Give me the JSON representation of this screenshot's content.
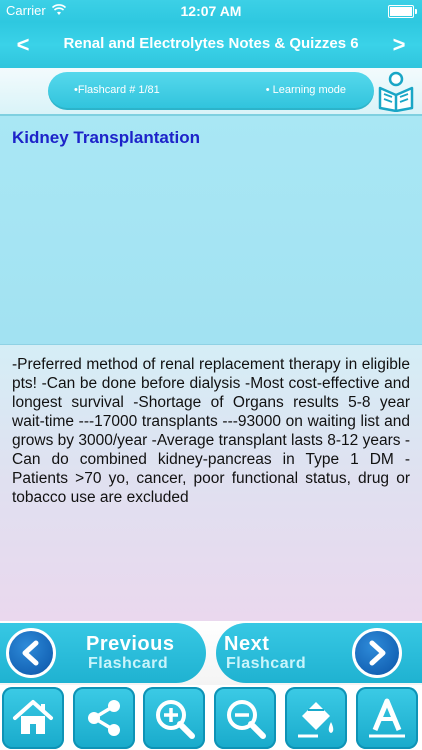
{
  "status_bar": {
    "carrier": "Carrier",
    "time": "12:07 AM"
  },
  "nav_bar": {
    "back_label": "<",
    "title": "Renal and Electrolytes Notes & Quizzes 6",
    "forward_label": ">"
  },
  "info": {
    "flashcard_number": "•Flashcard #  1/81",
    "mode": "• Learning mode"
  },
  "card": {
    "title": "Kidney Transplantation",
    "body": "-Preferred method of renal replacement therapy in eligible pts! -Can be done before dialysis -Most cost-effective and longest survival -Shortage of Organs results 5-8 year wait-time ---17000 transplants ---93000 on waiting list and grows by 3000/year -Average transplant lasts 8-12 years -Can do combined kidney-pancreas in Type 1 DM  -Patients >70 yo, cancer, poor functional status, drug or tobacco use are excluded"
  },
  "navigation": {
    "previous_big": "Previous",
    "previous_small": "Flashcard",
    "next_big": "Next",
    "next_small": "Flashcard"
  },
  "toolbar": {
    "items": [
      {
        "icon": "home-icon"
      },
      {
        "icon": "share-icon"
      },
      {
        "icon": "zoom-in-icon"
      },
      {
        "icon": "zoom-out-icon"
      },
      {
        "icon": "paint-bucket-icon"
      },
      {
        "icon": "font-icon"
      }
    ]
  },
  "colors": {
    "accent": "#2ec8e0",
    "title_text": "#1d23c9",
    "nav_circle": "#1565b7"
  }
}
